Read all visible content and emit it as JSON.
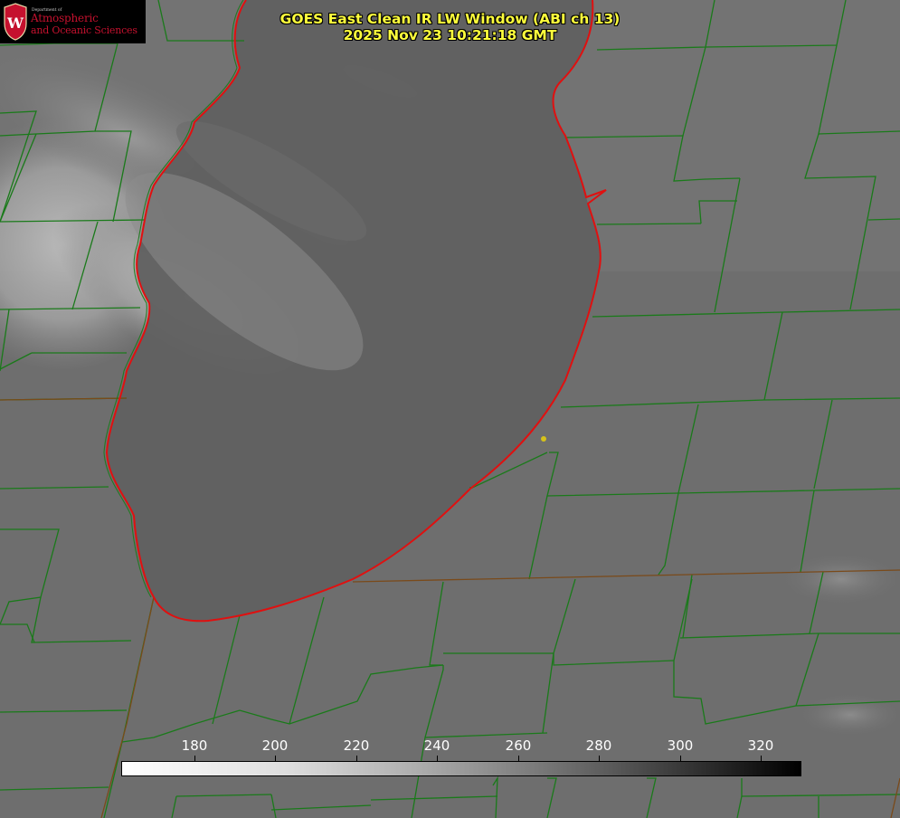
{
  "title": {
    "line1": "GOES East Clean IR LW Window (ABI ch 13)",
    "line2": "2025 Nov 23 10:21:18 GMT"
  },
  "logo": {
    "dept_label": "Department of",
    "line1": "Atmospheric",
    "line2": "and Oceanic Sciences",
    "crest_letter": "W",
    "icon": "uw-crest-icon"
  },
  "colorbar": {
    "ticks": [
      "180",
      "200",
      "220",
      "240",
      "260",
      "280",
      "300",
      "320"
    ],
    "min": 162,
    "max": 330,
    "palette": [
      "#ffffff",
      "#000000"
    ]
  },
  "colors": {
    "state_border": "#1a7a1a",
    "coastline": "#e01010",
    "title_text": "#ffff3c",
    "marker": "#d6c21a"
  }
}
